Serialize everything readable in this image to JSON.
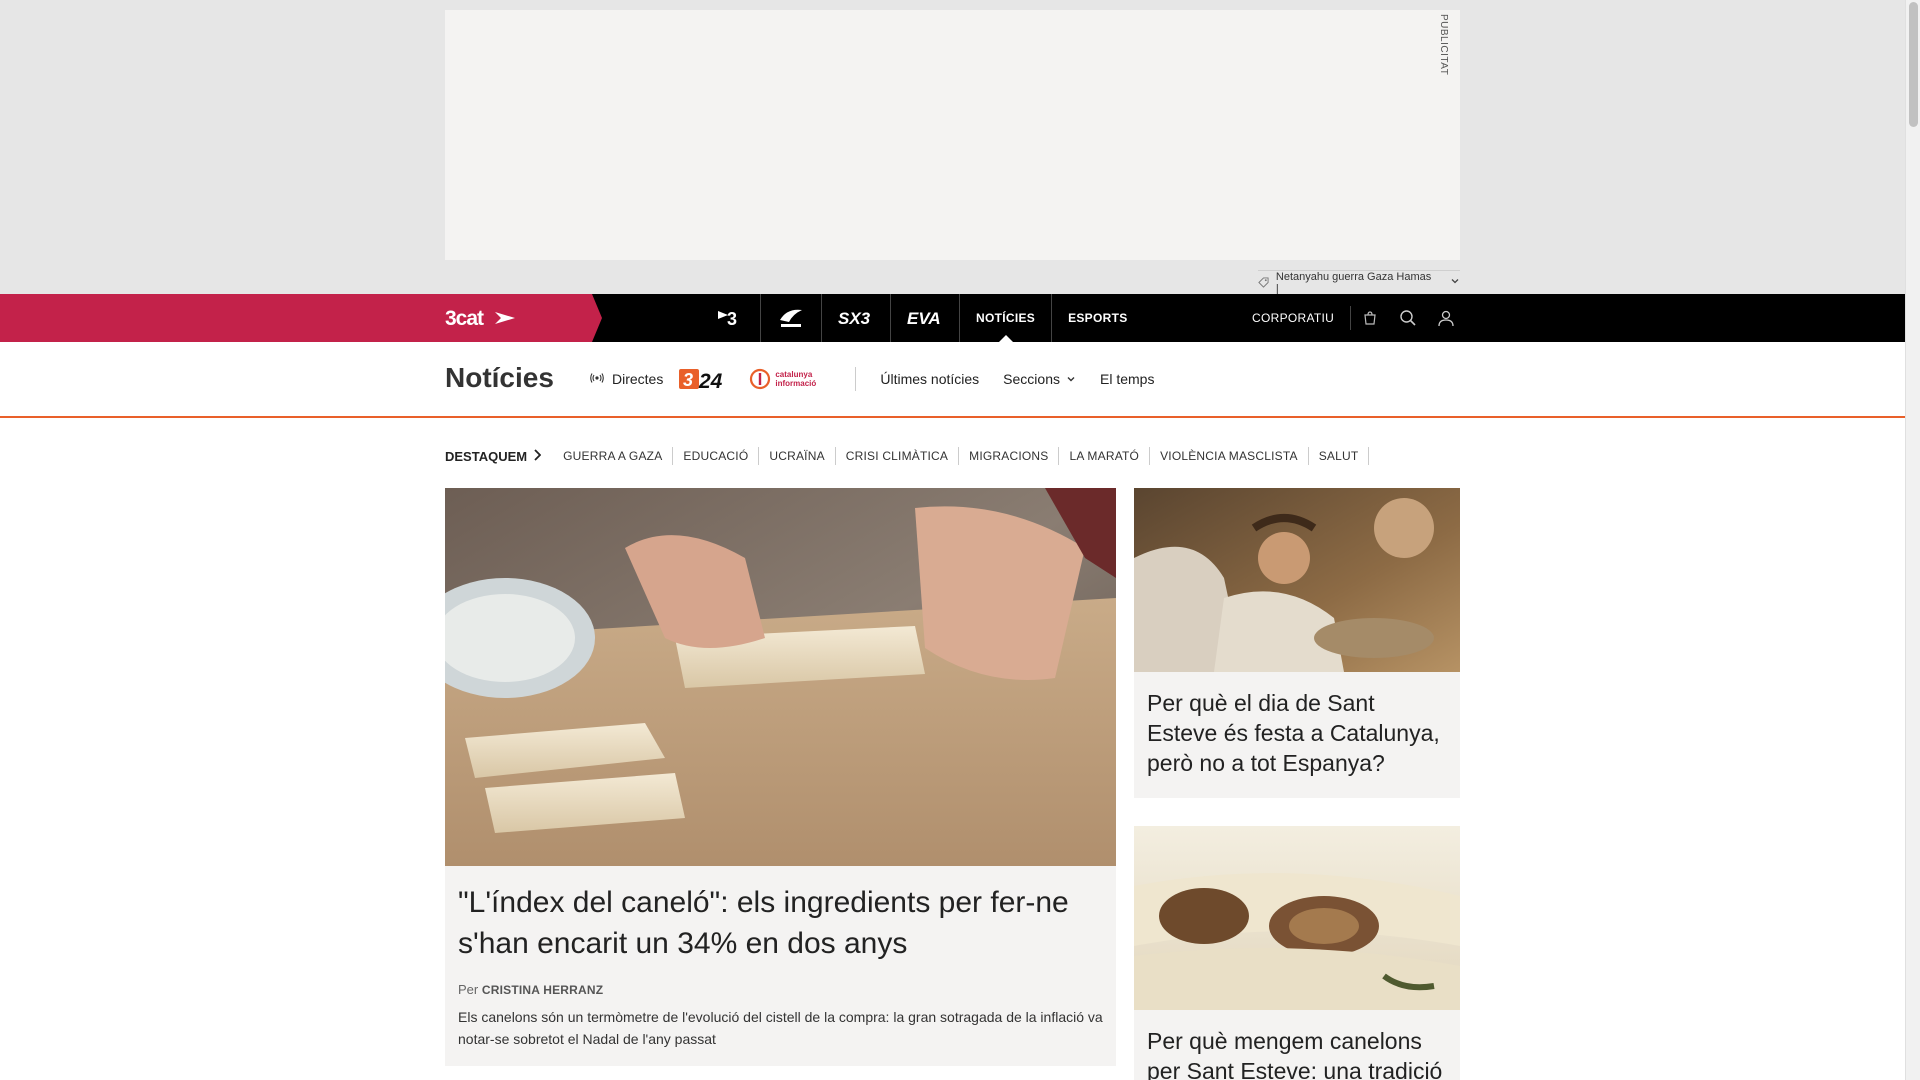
{
  "ad": {
    "label": "PUBLICITAT"
  },
  "tags": {
    "text": "Netanyahu guerra Gaza Hamas |"
  },
  "brand": {
    "name": "3cat"
  },
  "channels": [
    {
      "name": "tv3-logo",
      "label": "3"
    },
    {
      "name": "catradio-logo",
      "label": "Cat ràdio"
    },
    {
      "name": "sx3-logo",
      "label": "SX3"
    },
    {
      "name": "eva-logo",
      "label": "EVA"
    }
  ],
  "nav": {
    "noticies": "NOTÍCIES",
    "esports": "ESPORTS",
    "corporatiu": "CORPORATIU"
  },
  "section": {
    "title": "Notícies",
    "directes": "Directes",
    "logo_324": "324",
    "logo_ci": "catalunya informació",
    "ultimes": "Últimes notícies",
    "seccions": "Seccions",
    "temps": "El temps"
  },
  "highlights": {
    "head": "DESTAQUEM",
    "items": [
      "GUERRA A GAZA",
      "EDUCACIÓ",
      "UCRAÏNA",
      "CRISI CLIMÀTICA",
      "MIGRACIONS",
      "LA MARATÓ",
      "VIOLÈNCIA MASCLISTA",
      "SALUT"
    ]
  },
  "main_article": {
    "title": "\"L'índex del caneló\": els ingredients per fer-ne s'han encarit un 34% en dos anys",
    "by": "Per",
    "author": "CRISTINA HERRANZ",
    "summary": "Els canelons són un termòmetre de l'evolució del cistell de la compra: la gran sotragada de la inflació va notar-se sobretot el Nadal de l'any passat"
  },
  "side_articles": [
    {
      "title": "Per què el dia de Sant Esteve és festa a Catalunya, però no a tot Espanya?"
    },
    {
      "title": "Per què mengem canelons per Sant Esteve: una tradició que"
    }
  ],
  "colors": {
    "brand": "#c3224a",
    "accent": "#e9602a",
    "nav_bg": "#000000",
    "card_bg": "#f4f3f2"
  }
}
